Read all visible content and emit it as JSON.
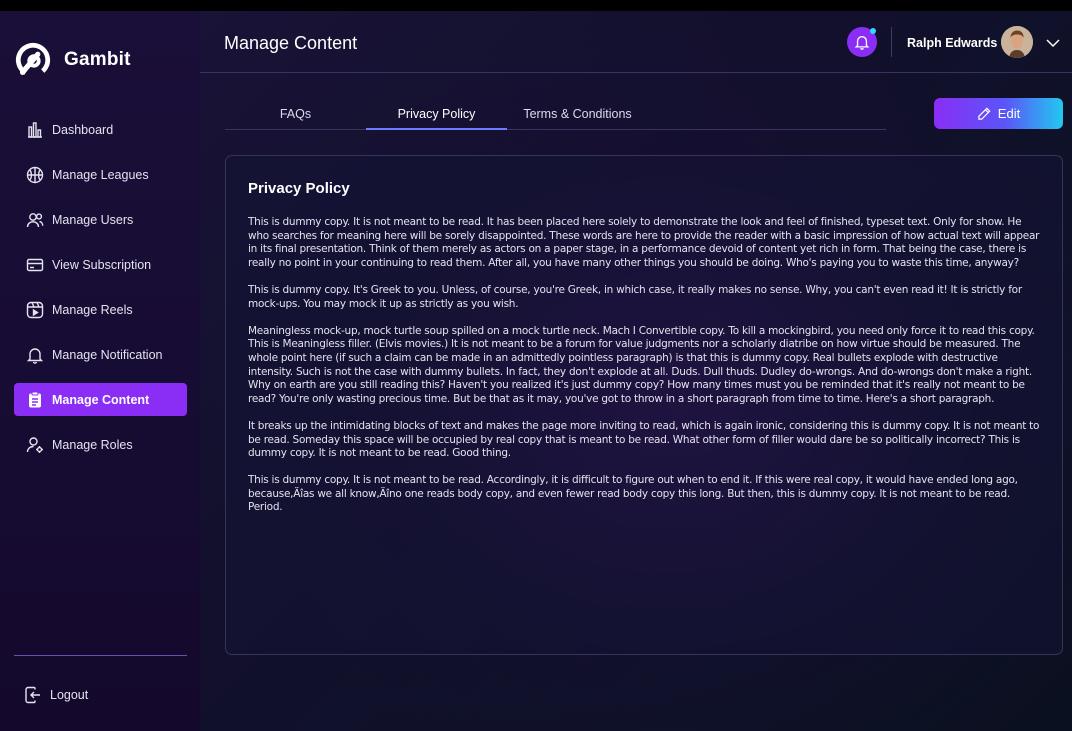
{
  "brand": {
    "name": "Gambit"
  },
  "sidebar": {
    "items": [
      {
        "label": "Dashboard",
        "icon": "bar-chart-icon",
        "active": false
      },
      {
        "label": "Manage Leagues",
        "icon": "basketball-icon",
        "active": false
      },
      {
        "label": "Manage Users",
        "icon": "users-icon",
        "active": false
      },
      {
        "label": "View Subscription",
        "icon": "card-icon",
        "active": false
      },
      {
        "label": "Manage Reels",
        "icon": "reels-icon",
        "active": false
      },
      {
        "label": "Manage Notification",
        "icon": "bell-icon",
        "active": false
      },
      {
        "label": "Manage Content",
        "icon": "clipboard-icon",
        "active": true
      },
      {
        "label": "Manage Roles",
        "icon": "user-gear-icon",
        "active": false
      }
    ],
    "logout": {
      "label": "Logout",
      "icon": "logout-icon"
    }
  },
  "header": {
    "title": "Manage Content",
    "user_name": "Ralph Edwards",
    "notification_icon": "bell-icon",
    "menu_icon": "chevron-down-icon"
  },
  "tabs": [
    {
      "label": "FAQs",
      "active": false
    },
    {
      "label": "Privacy Policy",
      "active": true
    },
    {
      "label": "Terms & Conditions",
      "active": false
    }
  ],
  "edit_button": {
    "label": "Edit",
    "icon": "pencil-icon"
  },
  "content": {
    "title": "Privacy Policy",
    "paragraphs": [
      "This is dummy copy. It is not meant to be read. It has been placed here solely to demonstrate the look and feel of finished, typeset text. Only for show. He who searches for meaning here will be sorely disappointed.  These words are here to provide the reader with a basic impression of how actual text will appear in its final presentation. Think of them merely as actors on a paper stage, in a performance devoid of content yet rich in form. That being the case, there is really no point in your continuing to read them. After all, you have many other things you should be doing. Who's paying you to waste this time, anyway?",
      "This is dummy copy. It's Greek to you. Unless, of course, you're Greek, in which case, it really makes no sense. Why, you can't even read it!  It is strictly for mock-ups. You may mock it up as strictly as you wish.",
      "Meaningless mock-up, mock turtle soup spilled on a mock turtle neck. Mach I Convertible copy. To kill a mockingbird, you need only force it to read this copy. This is Meaningless filler. (Elvis movies.) It is not meant to be a forum for value judgments nor a scholarly diatribe on how virtue should be measured. The whole point here (if such a claim can be made in an admittedly pointless paragraph) is that this is dummy copy.  Real bullets explode with destructive intensity. Such is not the case with dummy bullets. In fact, they don't explode at all. Duds. Dull thuds. Dudley do-wrongs. And do-wrongs don't make a right. Why on earth are you still reading this? Haven't you realized it's just dummy copy? How many times must you be reminded that it's really not meant to be read? You're only wasting precious time. But be that as it may, you've got to throw in a short paragraph from time to time. Here's a short paragraph.",
      "It breaks up the intimidating blocks of text and makes the page more inviting to read, which is again ironic, considering this is dummy copy. It is not meant to be read. Someday this space will be occupied by real copy that is meant to be read. What other form of filler would dare be so politically incorrect? This is dummy copy. It is not meant to be read. Good thing.",
      "This is dummy copy. It is not meant to be read. Accordingly, it is difficult to figure out when to end it. If this were real copy, it would have ended long ago, because,Äîas we all know,Äîno one reads body copy, and even fewer read body copy this long. But then, this is dummy copy. It is not meant to be read. Period."
    ]
  },
  "colors": {
    "accent": "#8a2ef5",
    "tab_underline": "#6c7bff",
    "notification_dot": "#2fd8ff"
  }
}
